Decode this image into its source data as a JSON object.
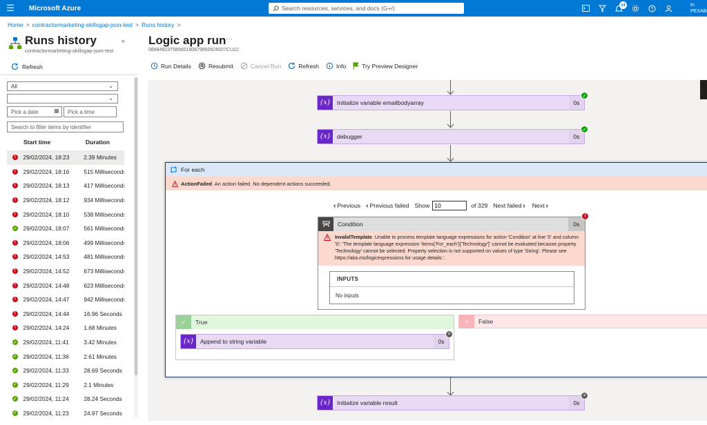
{
  "topbar": {
    "brand": "Microsoft Azure",
    "search_placeholder": "Search resources, services, and docs (G+/)",
    "notifications_count": "14",
    "user_name": "In",
    "user_tenant": "PEXABO"
  },
  "breadcrumb": {
    "home": "Home",
    "app": "contractormarketing-skillsgap-json-test",
    "current": "Runs history"
  },
  "left_panel": {
    "title": "Runs history",
    "subtitle": "contractormarketing-skillsgap-json-test",
    "refresh": "Refresh",
    "status_filter": "All",
    "second_filter": "",
    "date_placeholder": "Pick a date",
    "time_placeholder": "Pick a time",
    "identifier_placeholder": "Search to filter items by identifier",
    "col_start": "Start time",
    "col_duration": "Duration",
    "runs": [
      {
        "status": "fail",
        "start": "29/02/2024, 18:23",
        "duration": "2.39 Minutes"
      },
      {
        "status": "fail",
        "start": "29/02/2024, 18:16",
        "duration": "515 Milliseconds"
      },
      {
        "status": "fail",
        "start": "29/02/2024, 18:13",
        "duration": "417 Milliseconds"
      },
      {
        "status": "fail",
        "start": "29/02/2024, 18:12",
        "duration": "934 Milliseconds"
      },
      {
        "status": "fail",
        "start": "29/02/2024, 18:10",
        "duration": "538 Milliseconds"
      },
      {
        "status": "ok",
        "start": "29/02/2024, 18:07",
        "duration": "561 Milliseconds"
      },
      {
        "status": "fail",
        "start": "29/02/2024, 18:06",
        "duration": "499 Milliseconds"
      },
      {
        "status": "fail",
        "start": "29/02/2024, 14:53",
        "duration": "481 Milliseconds"
      },
      {
        "status": "fail",
        "start": "29/02/2024, 14:52",
        "duration": "673 Milliseconds"
      },
      {
        "status": "fail",
        "start": "29/02/2024, 14:48",
        "duration": "623 Milliseconds"
      },
      {
        "status": "fail",
        "start": "29/02/2024, 14:47",
        "duration": "942 Milliseconds"
      },
      {
        "status": "fail",
        "start": "29/02/2024, 14:44",
        "duration": "16.96 Seconds"
      },
      {
        "status": "fail",
        "start": "29/02/2024, 14:24",
        "duration": "1.68 Minutes"
      },
      {
        "status": "ok",
        "start": "29/02/2024, 11:41",
        "duration": "3.42 Minutes"
      },
      {
        "status": "ok",
        "start": "29/02/2024, 11:36",
        "duration": "2.61 Minutes"
      },
      {
        "status": "ok",
        "start": "29/02/2024, 11:33",
        "duration": "28.69 Seconds"
      },
      {
        "status": "ok",
        "start": "29/02/2024, 11:29",
        "duration": "2.1 Minutes"
      },
      {
        "status": "ok",
        "start": "29/02/2024, 11:24",
        "duration": "28.24 Seconds"
      },
      {
        "status": "ok",
        "start": "29/02/2024, 11:23",
        "duration": "24.97 Seconds"
      }
    ]
  },
  "run": {
    "title": "Logic app run",
    "more": "···",
    "id": "08584923758560180879850926027CU12",
    "toolbar": {
      "details": "Run Details",
      "resubmit": "Resubmit",
      "cancel": "Cancel Run",
      "refresh": "Refresh",
      "info": "Info",
      "preview": "Try Preview Designer"
    }
  },
  "workflow": {
    "action1": {
      "name": "Initialize variable emailbodyarray",
      "duration": "0s"
    },
    "action2": {
      "name": "debugger",
      "duration": "0s"
    },
    "foreach": {
      "title": "For each",
      "error_code": "ActionFailed",
      "error_msg": ". An action failed. No dependent actions succeeded.",
      "pager": {
        "previous": "Previous",
        "previous_failed": "Previous failed",
        "show": "Show",
        "value": "10",
        "of": "of 329",
        "next_failed": "Next failed",
        "next": "Next"
      },
      "condition": {
        "title": "Condition",
        "duration": "0s",
        "error_code": "InvalidTemplate",
        "error_msg": ". Unable to process template language expressions for action 'Condition' at line '0' and column '0': 'The template language expression 'items('For_each')['Technology']' cannot be evaluated because property 'Technology' cannot be selected. Property selection is not supported on values of type 'String'. Please see https://aka.ms/logicexpressions for usage details.'.",
        "inputs_label": "INPUTS",
        "inputs_value": "No inputs"
      },
      "true_label": "True",
      "false_label": "False",
      "append": {
        "name": "Append to string variable",
        "duration": "0s"
      }
    },
    "action3": {
      "name": "Initialize variable result",
      "duration": "0s"
    }
  },
  "colors": {
    "azure_blue": "#0078d4",
    "variable_purple": "#6b26c9",
    "error_red": "#c50f1f",
    "success_green": "#13a10e"
  }
}
